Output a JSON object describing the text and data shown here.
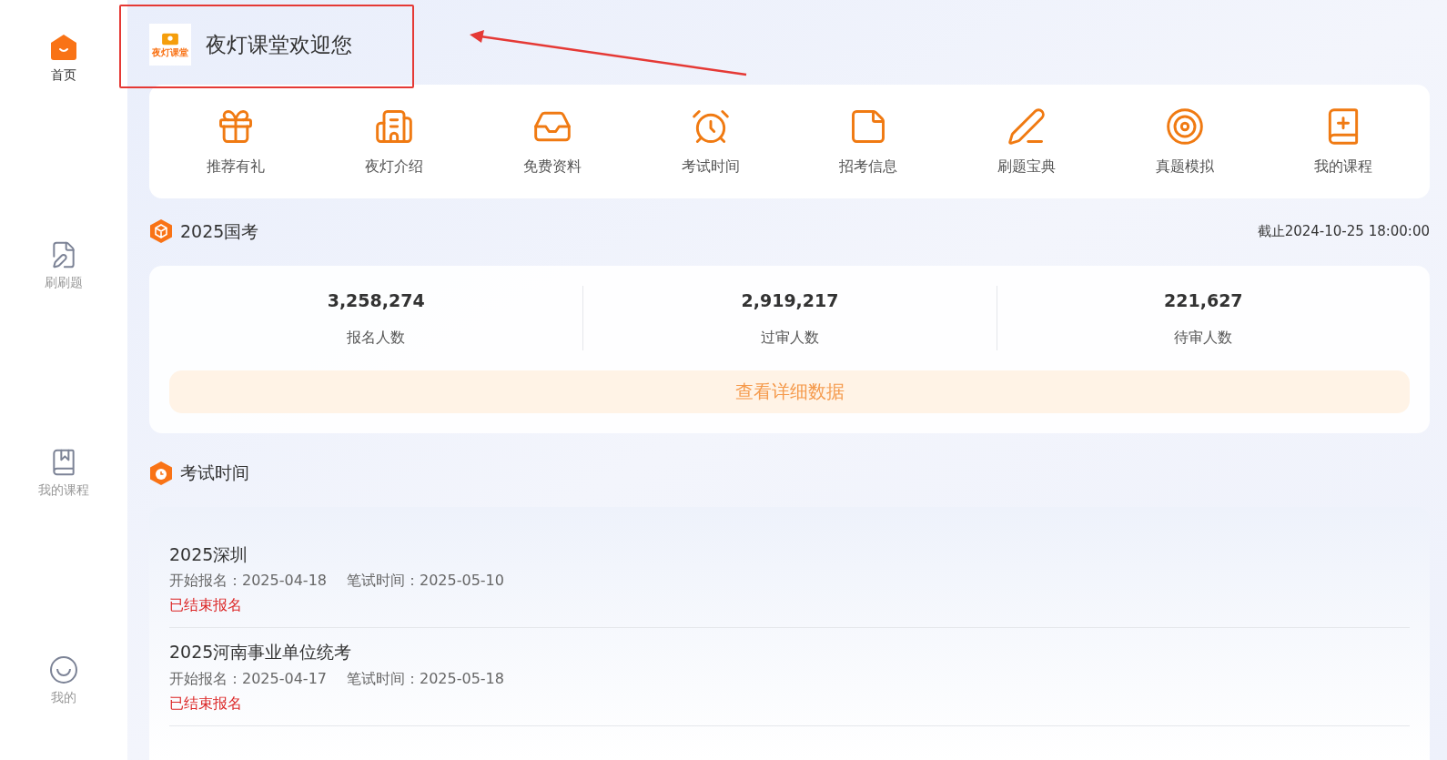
{
  "sidebar": {
    "items": [
      {
        "label": "首页",
        "selected": true
      },
      {
        "label": "刷刷题",
        "selected": false
      },
      {
        "label": "我的课程",
        "selected": false
      },
      {
        "label": "我的",
        "selected": false
      }
    ]
  },
  "header": {
    "logo_text": "夜灯课堂",
    "title": "夜灯课堂欢迎您"
  },
  "shortcuts": [
    {
      "label": "推荐有礼"
    },
    {
      "label": "夜灯介绍"
    },
    {
      "label": "免费资料"
    },
    {
      "label": "考试时间"
    },
    {
      "label": "招考信息"
    },
    {
      "label": "刷题宝典"
    },
    {
      "label": "真题模拟"
    },
    {
      "label": "我的课程"
    }
  ],
  "exam_stats": {
    "title": "2025国考",
    "deadline": "截止2024-10-25 18:00:00",
    "stats": [
      {
        "value": "3,258,274",
        "label": "报名人数"
      },
      {
        "value": "2,919,217",
        "label": "过审人数"
      },
      {
        "value": "221,627",
        "label": "待审人数"
      }
    ],
    "details_button": "查看详细数据"
  },
  "exam_schedule": {
    "title": "考试时间",
    "items": [
      {
        "name": "2025深圳",
        "signup_label": "开始报名：",
        "signup_date": "2025-04-18",
        "exam_label": "笔试时间：",
        "exam_date": "2025-05-10",
        "status": "已结束报名"
      },
      {
        "name": "2025河南事业单位统考",
        "signup_label": "开始报名：",
        "signup_date": "2025-04-17",
        "exam_label": "笔试时间：",
        "exam_date": "2025-05-18",
        "status": "已结束报名"
      }
    ]
  }
}
